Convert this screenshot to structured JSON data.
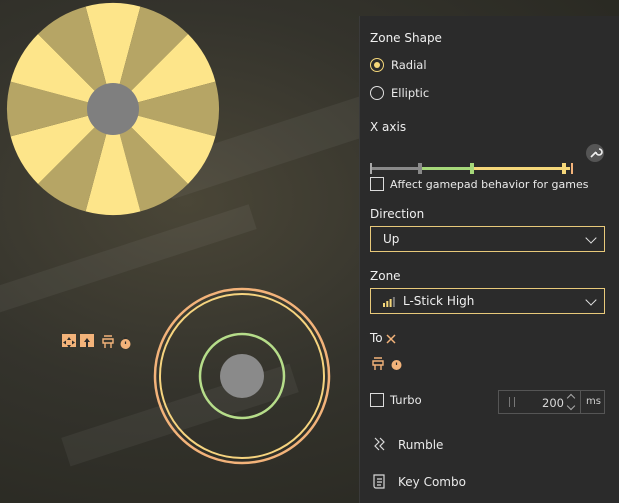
{
  "panel": {
    "zone_shape": {
      "title": "Zone Shape",
      "options": [
        {
          "label": "Radial",
          "selected": true
        },
        {
          "label": "Elliptic",
          "selected": false
        }
      ]
    },
    "x_axis": {
      "title": "X axis",
      "slider_stops": [
        0.0,
        0.25,
        0.5,
        1.0
      ]
    },
    "affect_gamepad": {
      "label": "Affect gamepad behavior for games",
      "checked": false
    },
    "direction": {
      "title": "Direction",
      "value": "Up"
    },
    "zone": {
      "title": "Zone",
      "value": "L-Stick High",
      "icon": "signal-bars-icon"
    },
    "to": {
      "title": "To",
      "icon": "close-x-icon"
    },
    "turbo": {
      "label": "Turbo",
      "checked": false,
      "value": "200",
      "unit": "ms"
    },
    "rumble": {
      "label": "Rumble",
      "icon": "vibration-icon"
    },
    "key_combo": {
      "label": "Key Combo",
      "icon": "scroll-icon"
    }
  },
  "colors": {
    "accent": "#f5d77a",
    "green": "#a6d87a",
    "orange": "#f3b37a",
    "sector_light": "#fde58a",
    "sector_dark": "#b6a565"
  }
}
